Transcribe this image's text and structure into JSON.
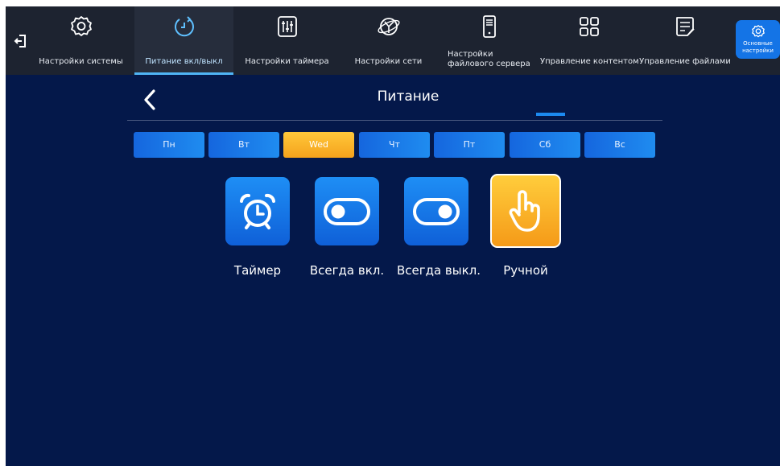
{
  "topbar": {
    "exit_icon": "exit-icon",
    "tabs": [
      {
        "label": "Настройки системы",
        "icon": "gear-icon"
      },
      {
        "label": "Питание вкл/выкл",
        "icon": "power-timer-icon"
      },
      {
        "label": "Настройки таймера",
        "icon": "sliders-icon"
      },
      {
        "label": "Настройки сети",
        "icon": "globe-icon"
      },
      {
        "label": "Настройки файлового сервера",
        "icon": "server-icon"
      },
      {
        "label": "Управление контентом",
        "icon": "grid-icon"
      },
      {
        "label": "Управление файлами",
        "icon": "document-icon"
      }
    ],
    "active_tab": 1,
    "basic_button": {
      "label": "Основные настройки",
      "icon": "gear-icon"
    }
  },
  "panel": {
    "title": "Питание",
    "back_icon": "chevron-left-icon",
    "days": [
      "Пн",
      "Вт",
      "Wed",
      "Чт",
      "Пт",
      "Сб",
      "Вс"
    ],
    "active_day": 2,
    "modes": [
      {
        "label": "Таймер",
        "icon": "alarm-clock-icon"
      },
      {
        "label": "Всегда вкл.",
        "icon": "toggle-on-icon"
      },
      {
        "label": "Всегда выкл.",
        "icon": "toggle-off-icon"
      },
      {
        "label": "Ручной",
        "icon": "hand-pointer-icon"
      }
    ],
    "active_mode": 3
  },
  "colors": {
    "background": "#04184a",
    "topbar": "#1d2330",
    "accent_blue": "#1f8cf0",
    "accent_orange": "#f5a21c"
  }
}
